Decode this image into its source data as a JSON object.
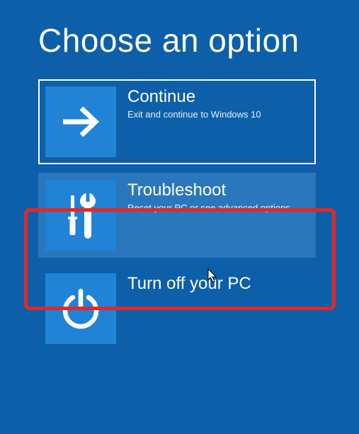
{
  "heading": "Choose an option",
  "options": [
    {
      "title": "Continue",
      "desc": "Exit and continue to Windows 10"
    },
    {
      "title": "Troubleshoot",
      "desc": "Reset your PC or see advanced options"
    },
    {
      "title": "Turn off your PC",
      "desc": ""
    }
  ]
}
